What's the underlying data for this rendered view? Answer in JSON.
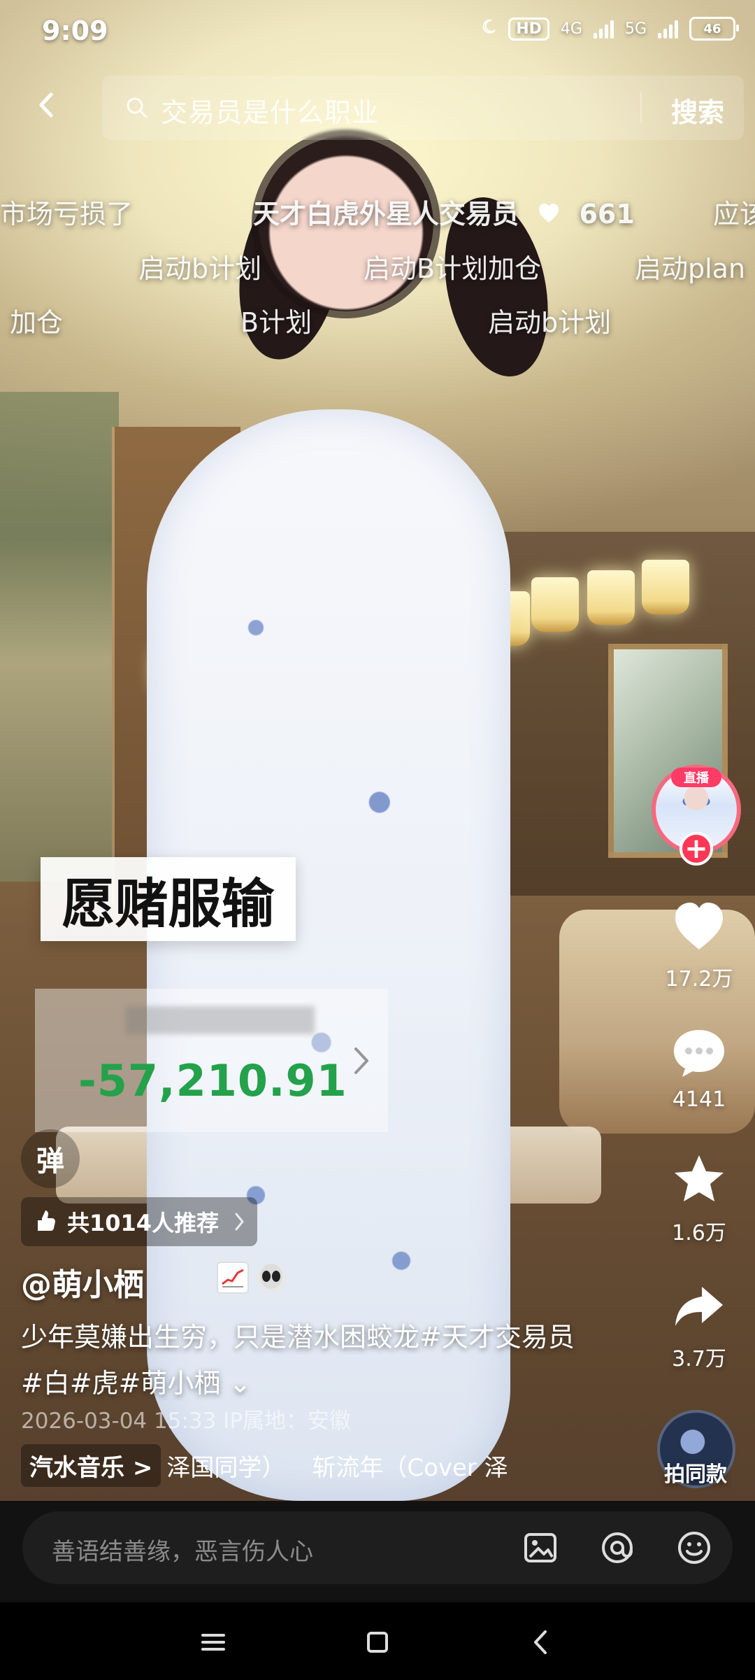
{
  "status_bar": {
    "time": "9:09",
    "network": "HD",
    "network_type_1": "4G",
    "network_type_2": "5G",
    "battery": "46"
  },
  "search": {
    "placeholder": "交易员是什么职业",
    "button": "搜索"
  },
  "danmaku": [
    "市场亏损了",
    "天才白虎外星人交易员",
    "661",
    "应该",
    "启动b计划",
    "启动B计划加仓",
    "启动plan",
    "加仓",
    "B计划",
    "启动b计划"
  ],
  "overlay": {
    "bet_text": "愿赌服输",
    "loss_value": "-57,210.91"
  },
  "left_controls": {
    "danmu_button": "弹",
    "recommend_text": "共1014人推荐"
  },
  "post": {
    "author": "@萌小栖",
    "caption": "少年莫嫌出生穷，只是潜水困蛟龙#天才交易员#白#虎#萌小栖",
    "expand": "⌄",
    "meta": "2026-03-04 15:33  IP属地：安徽"
  },
  "music": {
    "chip_label": "汽水音乐 >",
    "track_1": "泽国同学）",
    "track_2": "斩流年（Cover 泽"
  },
  "right_rail": {
    "live_label": "直播",
    "likes": "17.2万",
    "comments": "4141",
    "favorites": "1.6万",
    "shares": "3.7万",
    "same_style_label": "拍同款"
  },
  "comment_box": {
    "placeholder": "善语结善缘，恶言伤人心"
  },
  "icons": {
    "back": "back-icon",
    "search": "search-icon",
    "heart": "heart-icon",
    "comment": "comment-icon",
    "star": "star-icon",
    "share": "share-icon",
    "image": "image-icon",
    "at": "at-icon",
    "emoji": "emoji-icon",
    "menu": "menu-icon",
    "home": "home-icon",
    "nav_back": "nav-back-icon"
  },
  "colors": {
    "accent_red": "#ff3655",
    "loss_green": "#24a14b"
  }
}
